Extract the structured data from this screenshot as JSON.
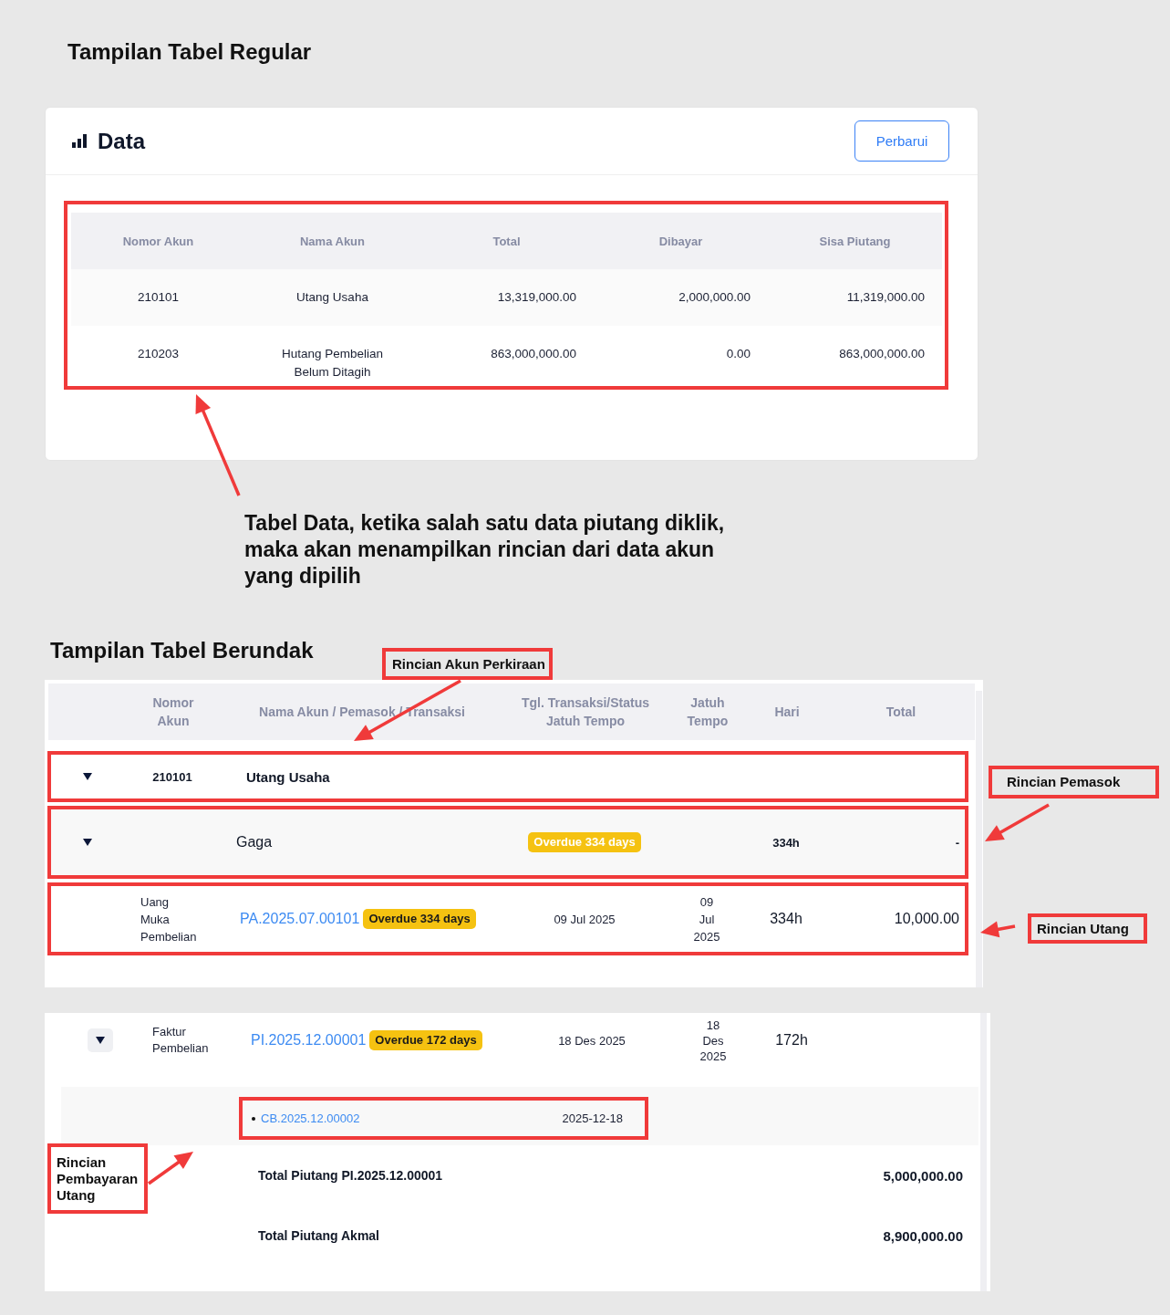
{
  "regular_view": {
    "heading": "Tampilan Tabel Regular",
    "card": {
      "title": "Data",
      "button": "Perbarui",
      "table": {
        "highlighted": true,
        "columns": [
          "Nomor Akun",
          "Nama Akun",
          "Total",
          "Dibayar",
          "Sisa Piutang"
        ],
        "rows": [
          [
            "210101",
            "Utang Usaha",
            "13,319,000.00",
            "2,000,000.00",
            "11,319,000.00"
          ],
          [
            "210203",
            "Hutang Pembelian Belum Ditagih",
            "863,000,000.00",
            "0.00",
            "863,000,000.00"
          ]
        ]
      }
    }
  },
  "note": "Tabel Data, ketika salah satu data piutang diklik, maka akan menampilkan rincian dari data akun yang dipilih",
  "nested_view": {
    "heading": "Tampilan Tabel Berundak",
    "columns": [
      "Nomor Akun",
      "Nama Akun / Pemasok / Transaksi",
      "Tgl. Transaksi/Status Jatuh Tempo",
      "Jatuh Tempo",
      "Hari",
      "Total"
    ],
    "rows": [
      {
        "kind": "account",
        "number": "210101",
        "name": "Utang Usaha",
        "expanded": true,
        "highlighted": true,
        "children": [
          {
            "kind": "supplier",
            "name": "Gaga",
            "badge": "Overdue 334 days",
            "days": "334h",
            "total": "-",
            "expanded": true,
            "highlighted": true,
            "children": [
              {
                "kind": "transaction",
                "type": "Uang Muka Pembelian",
                "number": "PA.2025.07.00101",
                "badge": "Overdue 334 days",
                "date": "09 Jul 2025",
                "due": "09 Jul 2025",
                "days": "334h",
                "total": "10,000.00",
                "highlighted": true
              }
            ]
          }
        ]
      }
    ]
  },
  "nested_view_excerpt": {
    "rows": [
      {
        "kind": "transaction",
        "type": "Faktur Pembelian",
        "number": "PI.2025.12.00001",
        "badge": "Overdue 172 days",
        "date": "18 Des 2025",
        "due": "18 Des 2025",
        "days": "172h",
        "expanded": true,
        "highlighted": false,
        "children": [
          {
            "kind": "payment",
            "number": "CB.2025.12.00002",
            "date": "2025-12-18",
            "highlighted": true
          }
        ]
      }
    ],
    "totals": [
      {
        "label": "Total Piutang PI.2025.12.00001",
        "value": "5,000,000.00"
      },
      {
        "label": "Total Piutang Akmal",
        "value": "8,900,000.00"
      }
    ]
  },
  "callouts": [
    "Rincian Akun Perkiraan",
    "Rincian Pemasok",
    "Rincian Utang",
    "Rincian Pembayaran Utang"
  ]
}
